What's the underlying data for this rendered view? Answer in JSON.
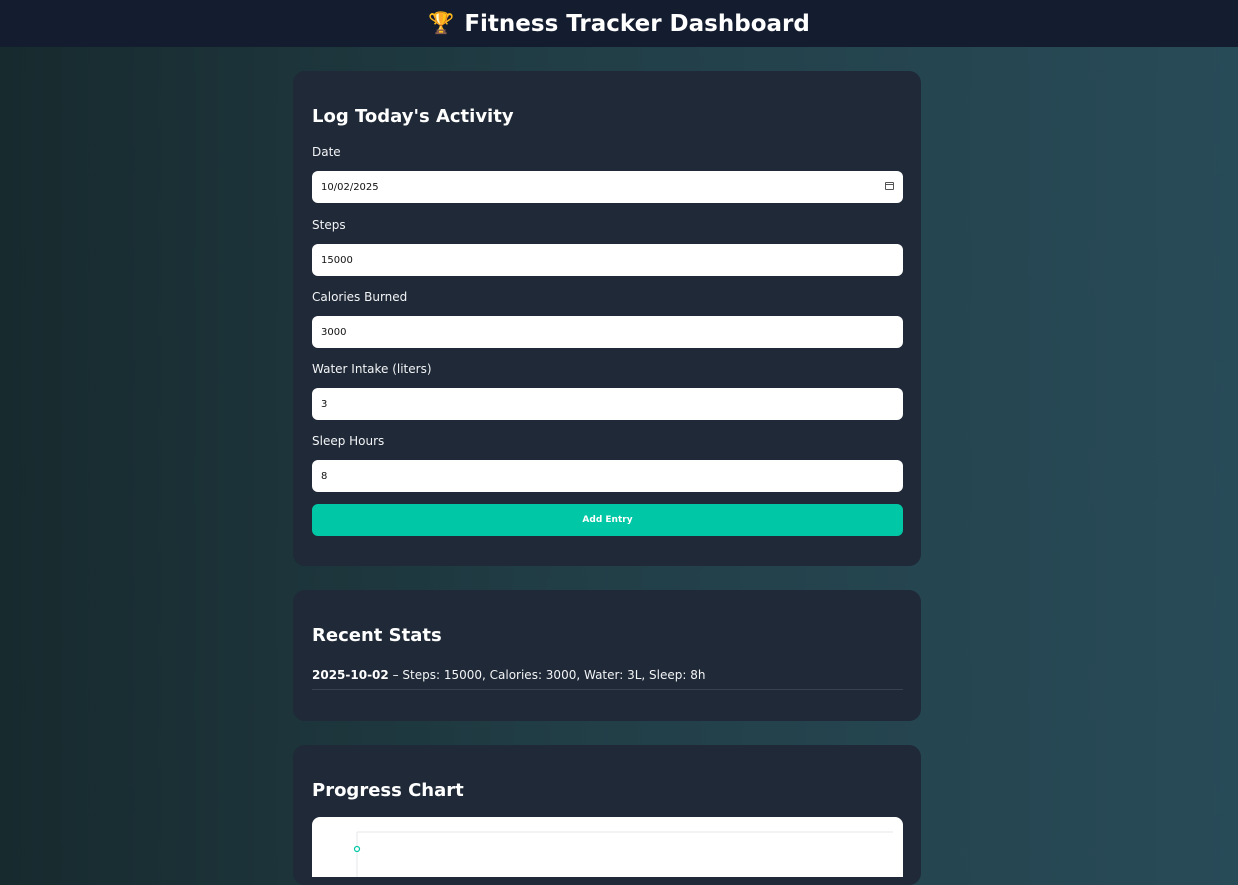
{
  "header": {
    "trophy_icon": "🏆",
    "title": "Fitness Tracker Dashboard"
  },
  "log_form": {
    "title": "Log Today's Activity",
    "fields": [
      {
        "label": "Date",
        "value": "10/02/2025"
      },
      {
        "label": "Steps",
        "value": "15000"
      },
      {
        "label": "Calories Burned",
        "value": "3000"
      },
      {
        "label": "Water Intake (liters)",
        "value": "3"
      },
      {
        "label": "Sleep Hours",
        "value": "8"
      }
    ],
    "submit_label": "Add Entry"
  },
  "recent_stats": {
    "title": "Recent Stats",
    "entries": [
      {
        "date": "2025-10-02",
        "summary": " – Steps: 15000, Calories: 3000, Water: 3L, Sleep: 8h"
      }
    ]
  },
  "progress_chart": {
    "title": "Progress Chart"
  },
  "chart_data": {
    "type": "line",
    "x": [
      "2025-10-02"
    ],
    "series": [],
    "grid": true
  },
  "colors": {
    "accent": "#00c7a6",
    "card": "#1f2937",
    "header": "#141c2f"
  }
}
